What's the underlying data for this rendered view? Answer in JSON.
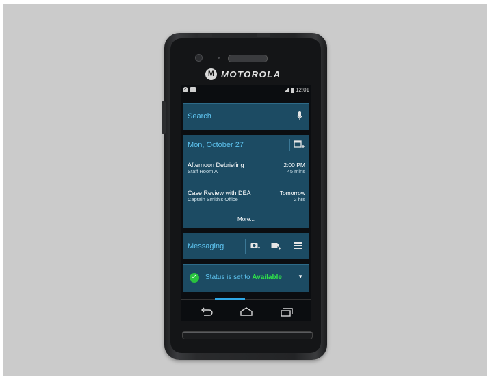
{
  "brand": {
    "name": "MOTOROLA",
    "logo": "M"
  },
  "statusbar": {
    "time": "12:01"
  },
  "search": {
    "label": "Search"
  },
  "calendar": {
    "date": "Mon, October 27",
    "events": [
      {
        "title": "Afternoon Debriefing",
        "location": "Staff Room A",
        "time": "2:00 PM",
        "duration": "45 mins"
      },
      {
        "title": "Case Review with DEA",
        "location": "Captain Smith's Office",
        "time": "Tomorrow",
        "duration": "2 hrs"
      }
    ],
    "more_label": "More..."
  },
  "messaging": {
    "label": "Messaging"
  },
  "status": {
    "prefix": "Status is set to ",
    "value": "Available"
  },
  "colors": {
    "card": "#1c4b63",
    "accent": "#5ec4f0",
    "available": "#2fe04a",
    "background": "#cbcbcb"
  }
}
